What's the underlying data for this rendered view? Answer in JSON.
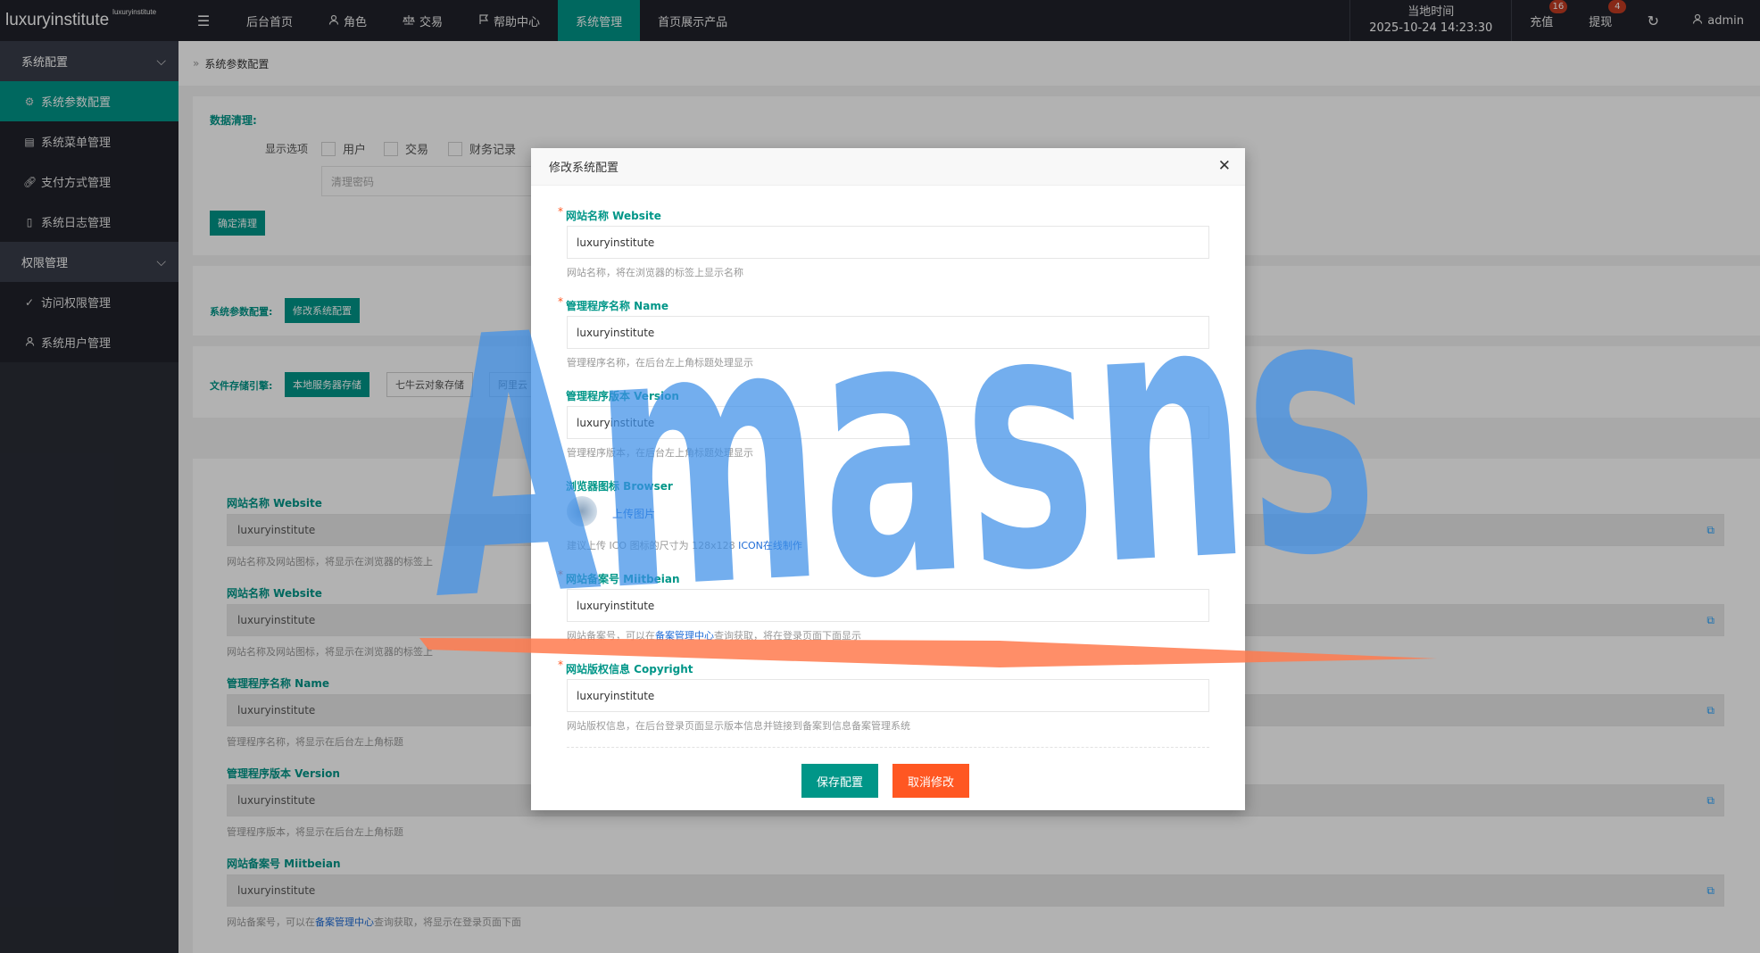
{
  "app": {
    "logo_main": "luxuryinstitute",
    "logo_sup": "luxuryinstitute"
  },
  "topnav": {
    "menu_icon": "menu-icon",
    "items": [
      {
        "label": "后台首页",
        "icon": ""
      },
      {
        "label": "角色",
        "icon": "user-icon"
      },
      {
        "label": "交易",
        "icon": "balance-icon"
      },
      {
        "label": "帮助中心",
        "icon": "flag-icon"
      },
      {
        "label": "系统管理",
        "icon": "",
        "active": true
      },
      {
        "label": "首页展示产品",
        "icon": ""
      }
    ],
    "clock_label": "当地时间",
    "clock_time": "2025-10-24 14:23:30",
    "recharge_label": "充值",
    "recharge_badge": "16",
    "withdraw_label": "提现",
    "withdraw_badge": "4",
    "user_name": "admin"
  },
  "sidebar": {
    "groups": [
      {
        "label": "系统配置",
        "items": [
          {
            "label": "系统参数配置",
            "icon": "gear-icon",
            "active": true
          },
          {
            "label": "系统菜单管理",
            "icon": "table-icon"
          },
          {
            "label": "支付方式管理",
            "icon": "link-icon"
          },
          {
            "label": "系统日志管理",
            "icon": "file-icon"
          }
        ]
      },
      {
        "label": "权限管理",
        "items": [
          {
            "label": "访问权限管理",
            "icon": "shield-check-icon"
          },
          {
            "label": "系统用户管理",
            "icon": "user-icon"
          }
        ]
      }
    ]
  },
  "breadcrumb": {
    "current": "系统参数配置"
  },
  "cleanup": {
    "title": "数据清理:",
    "options_label": "显示选项",
    "options": [
      "用户",
      "交易",
      "财务记录"
    ],
    "password_placeholder": "清理密码",
    "confirm_button": "确定清理"
  },
  "sysparams": {
    "title": "系统参数配置:",
    "edit_button": "修改系统配置"
  },
  "storage": {
    "title": "文件存储引擎:",
    "engines": [
      "本地服务器存储",
      "七牛云对象存储",
      "阿里云"
    ]
  },
  "config_list": [
    {
      "label": "网站名称 Website",
      "value": "luxuryinstitute",
      "help": "网站名称及网站图标，将显示在浏览器的标签上"
    },
    {
      "label": "网站名称 Website",
      "value": "luxuryinstitute",
      "help": "网站名称及网站图标，将显示在浏览器的标签上"
    },
    {
      "label": "管理程序名称 Name",
      "value": "luxuryinstitute",
      "help": "管理程序名称，将显示在后台左上角标题"
    },
    {
      "label": "管理程序版本 Version",
      "value": "luxuryinstitute",
      "help": "管理程序版本，将显示在后台左上角标题"
    },
    {
      "label": "网站备案号 Miitbeian",
      "value": "luxuryinstitute",
      "help_pre": "网站备案号，可以在",
      "help_link": "备案管理中心",
      "help_post": "查询获取，将显示在登录页面下面"
    }
  ],
  "modal": {
    "title": "修改系统配置",
    "close_icon": "close-icon",
    "fields": {
      "website_label": "网站名称 Website",
      "website_value": "luxuryinstitute",
      "website_help": "网站名称，将在浏览器的标签上显示名称",
      "name_label": "管理程序名称 Name",
      "name_value": "luxuryinstitute",
      "name_help": "管理程序名称，在后台左上角标题处理显示",
      "version_label": "管理程序版本 Version",
      "version_value": "luxuryinstitute",
      "version_help": "管理程序版本，在后台左上角标题处理显示",
      "browser_label": "浏览器图标 Browser",
      "upload_label": "上传图片",
      "browser_help_pre": "建议上传 ICO 图标的尺寸为 128x128 ",
      "browser_help_link": "ICON在线制作",
      "miitbeian_label": "网站备案号 Miitbeian",
      "miitbeian_value": "luxuryinstitute",
      "miitbeian_help_pre": "网站备案号，可以在",
      "miitbeian_help_link": "备案管理中心",
      "miitbeian_help_post": "查询获取，将在登录页面下面显示",
      "copyright_label": "网站版权信息 Copyright",
      "copyright_value": "luxuryinstitute",
      "copyright_help": "网站版权信息，在后台登录页面显示版本信息并链接到备案到信息备案管理系统"
    },
    "save_button": "保存配置",
    "cancel_button": "取消修改"
  },
  "watermark": {
    "text": "Amasns",
    "color": "#3d8fe8",
    "stroke_color": "#ff7a4d"
  },
  "colors": {
    "accent": "#009688",
    "danger": "#ff5722",
    "topbar": "#20222a",
    "badge": "#c23b22"
  }
}
